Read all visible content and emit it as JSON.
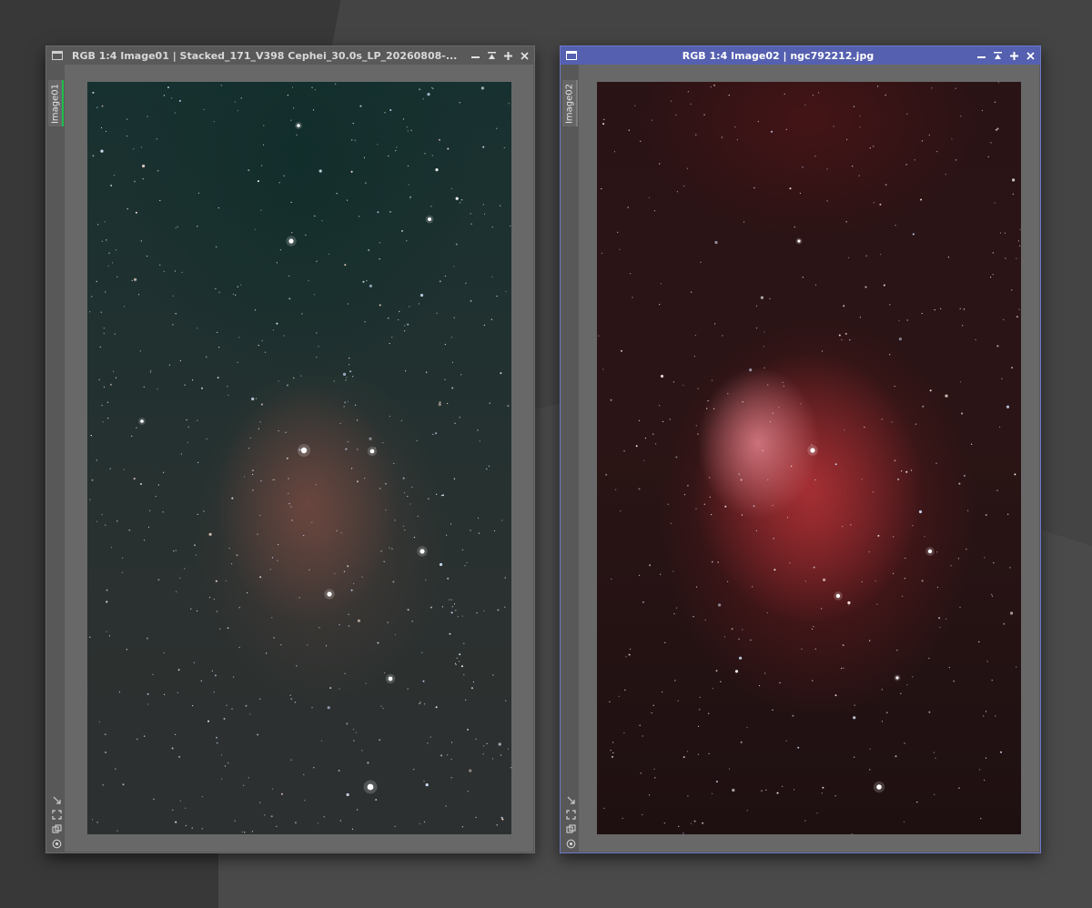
{
  "windows": [
    {
      "title": "RGB 1:4 Image01 | Stacked_171_V398 Cephei_30.0s_LP_20260808-...",
      "tab_label": "Image01",
      "active": false
    },
    {
      "title": "RGB 1:4 Image02 | ngc792212.jpg",
      "tab_label": "Image02",
      "active": true
    }
  ],
  "title_controls": [
    "minimize-icon",
    "shade-icon",
    "maximize-icon",
    "close-icon"
  ],
  "side_icons": [
    "zoom-to-fit-icon",
    "fit-view-icon",
    "clone-view-icon",
    "target-icon"
  ],
  "colors": {
    "desktop": "#3d3d3d",
    "active_titlebar": "#5560b0",
    "inactive_titlebar": "#595959",
    "active_tab_indicator": "#1fbf4a"
  }
}
